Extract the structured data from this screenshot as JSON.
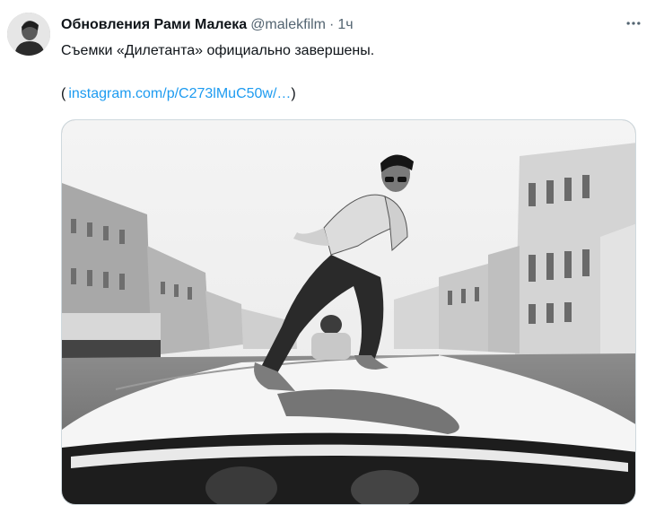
{
  "tweet": {
    "author_name": "Обновления Рами Малека",
    "author_handle": "@malekfilm",
    "separator": "·",
    "time": "1ч",
    "text": "Съемки «Дилетанта» официально завершены.",
    "link_open": "(",
    "link_text": "instagram.com/p/C273lMuC50w/…",
    "link_close": ")"
  },
  "icons": {
    "more": "more-horizontal-icon",
    "avatar": "avatar"
  },
  "colors": {
    "name": "#0f1419",
    "secondary": "#536471",
    "link": "#1d9bf0",
    "border": "#cfd9de"
  }
}
